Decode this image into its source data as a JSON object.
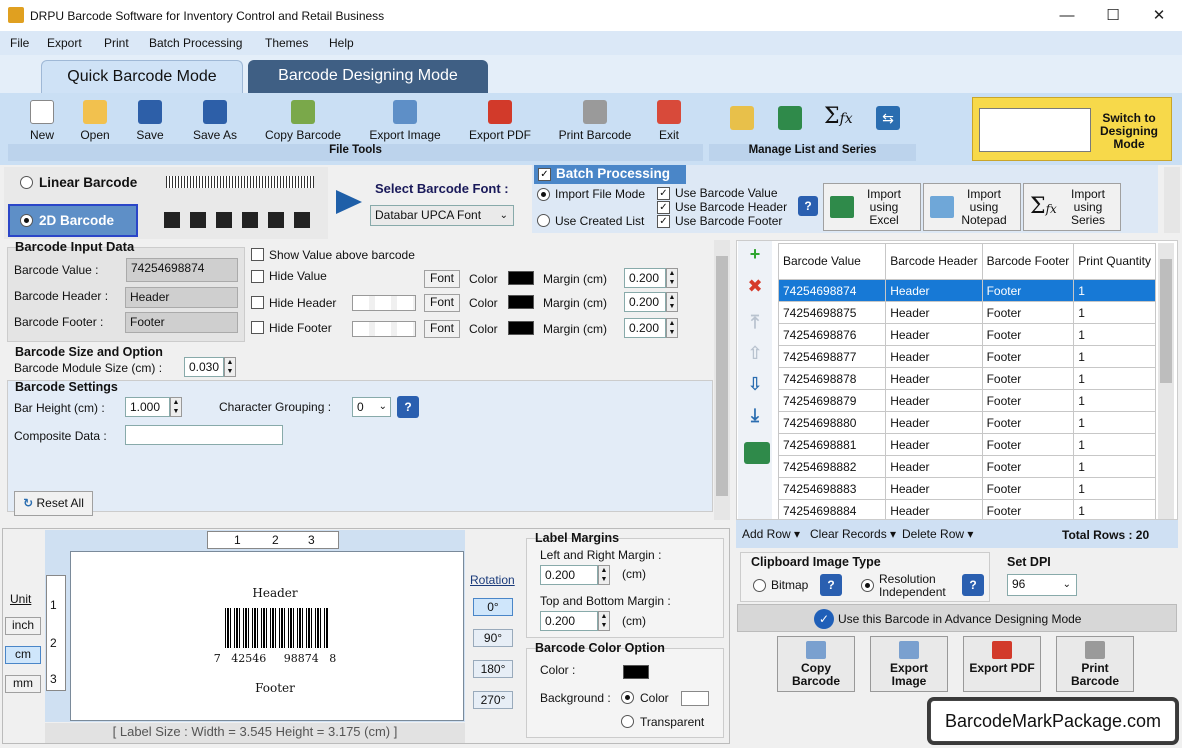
{
  "window": {
    "title": "DRPU Barcode Software for Inventory Control and Retail Business"
  },
  "menu": [
    "File",
    "Export",
    "Print",
    "Batch Processing",
    "Themes",
    "Help"
  ],
  "tabs": {
    "quick": "Quick Barcode Mode",
    "designing": "Barcode Designing Mode"
  },
  "toolbar": {
    "file_tools": [
      "New",
      "Open",
      "Save",
      "Save As",
      "Copy Barcode",
      "Export Image",
      "Export PDF",
      "Print Barcode",
      "Exit"
    ],
    "file_tools_label": "File Tools",
    "manage_label": "Manage List and Series",
    "switch_label": "Switch to Designing Mode"
  },
  "barcode_type": {
    "linear": "Linear Barcode",
    "twod": "2D Barcode",
    "select_font_label": "Select Barcode Font :",
    "font": "Databar UPCA Font"
  },
  "batch": {
    "title": "Batch Processing",
    "import_file": "Import File Mode",
    "created_list": "Use Created List",
    "use_value": "Use Barcode Value",
    "use_header": "Use Barcode Header",
    "use_footer": "Use Barcode Footer",
    "import_excel": "Import using Excel",
    "import_notepad": "Import using Notepad",
    "import_series": "Import using Series"
  },
  "input": {
    "title": "Barcode Input Data",
    "value_label": "Barcode Value :",
    "value": "74254698874",
    "header_label": "Barcode Header :",
    "header": "Header",
    "footer_label": "Barcode Footer :",
    "footer": "Footer",
    "show_above": "Show Value above barcode",
    "hide_value": "Hide Value",
    "hide_header": "Hide Header",
    "hide_footer": "Hide Footer",
    "font": "Font",
    "color": "Color",
    "margin": "Margin (cm)",
    "margin_value": "0.200"
  },
  "size": {
    "title": "Barcode Size and Option",
    "module_label": "Barcode Module Size (cm) :",
    "module": "0.030"
  },
  "settings": {
    "title": "Barcode Settings",
    "bar_height_label": "Bar Height (cm) :",
    "bar_height": "1.000",
    "grouping_label": "Character Grouping :",
    "grouping": "0",
    "composite_label": "Composite Data :",
    "reset": "Reset All"
  },
  "grid": {
    "headers": [
      "Barcode Value",
      "Barcode Header",
      "Barcode Footer",
      "Print Quantity"
    ],
    "rows": [
      [
        "74254698874",
        "Header",
        "Footer",
        "1"
      ],
      [
        "74254698875",
        "Header",
        "Footer",
        "1"
      ],
      [
        "74254698876",
        "Header",
        "Footer",
        "1"
      ],
      [
        "74254698877",
        "Header",
        "Footer",
        "1"
      ],
      [
        "74254698878",
        "Header",
        "Footer",
        "1"
      ],
      [
        "74254698879",
        "Header",
        "Footer",
        "1"
      ],
      [
        "74254698880",
        "Header",
        "Footer",
        "1"
      ],
      [
        "74254698881",
        "Header",
        "Footer",
        "1"
      ],
      [
        "74254698882",
        "Header",
        "Footer",
        "1"
      ],
      [
        "74254698883",
        "Header",
        "Footer",
        "1"
      ],
      [
        "74254698884",
        "Header",
        "Footer",
        "1"
      ]
    ],
    "add_row": "Add Row",
    "clear": "Clear Records",
    "delete": "Delete Row",
    "total": "Total Rows : 20"
  },
  "clipboard": {
    "title": "Clipboard Image Type",
    "bitmap": "Bitmap",
    "resolution": "Resolution Independent",
    "dpi_title": "Set DPI",
    "dpi": "96",
    "advance": "Use this Barcode in Advance Designing Mode"
  },
  "actions": [
    "Copy Barcode",
    "Export Image",
    "Export PDF",
    "Print Barcode"
  ],
  "preview": {
    "unit": "Unit",
    "inch": "inch",
    "cm": "cm",
    "mm": "mm",
    "rotation": "Rotation",
    "rotations": [
      "0°",
      "90°",
      "180°",
      "270°"
    ],
    "header": "Header",
    "footer": "Footer",
    "digits": "7   42546     98874   8",
    "label_size": "[ Label Size : Width = 3.545  Height = 3.175 (cm) ]",
    "ruler_h": [
      "1",
      "2",
      "3"
    ],
    "ruler_v": [
      "1",
      "2",
      "3"
    ]
  },
  "margins": {
    "title": "Label Margins",
    "lr_label": "Left and Right Margin :",
    "lr": "0.200",
    "tb_label": "Top and Bottom Margin :",
    "tb": "0.200",
    "unit": "(cm)"
  },
  "color_option": {
    "title": "Barcode Color Option",
    "color": "Color :",
    "background": "Background :",
    "bg_color": "Color",
    "transparent": "Transparent"
  },
  "watermark": "BarcodeMarkPackage.com"
}
